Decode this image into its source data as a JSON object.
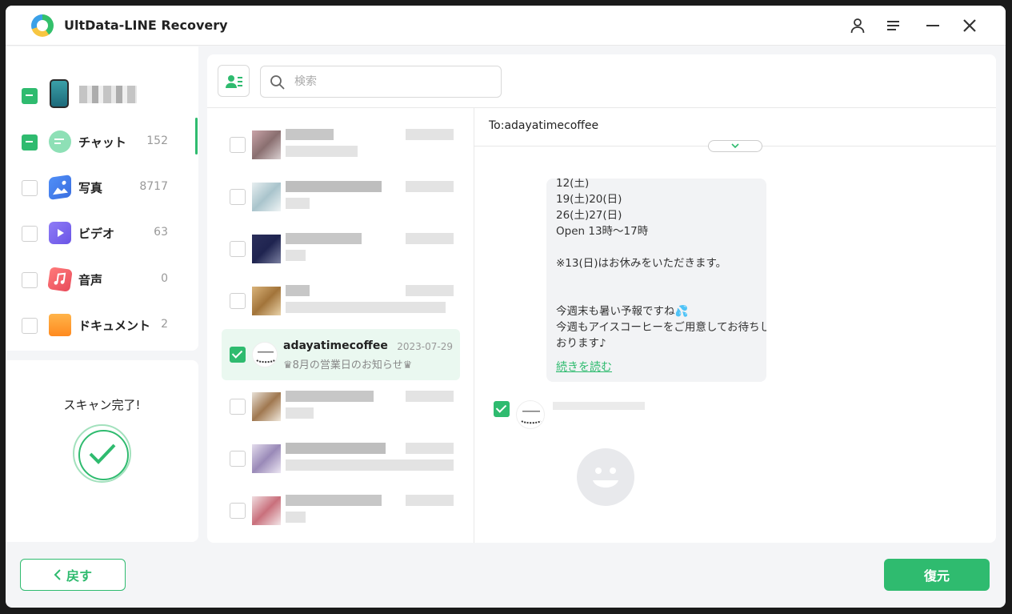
{
  "app": {
    "title": "UltData-LINE Recovery"
  },
  "titlebar": {
    "icons": [
      "user-icon",
      "menu-icon",
      "minimize-icon",
      "close-icon"
    ]
  },
  "sidebar": {
    "items": [
      {
        "label": "",
        "count": "",
        "icon": "phone-icon",
        "state": "partial"
      },
      {
        "label": "チャット",
        "count": "152",
        "icon": "chat-icon",
        "state": "partial"
      },
      {
        "label": "写真",
        "count": "8717",
        "icon": "photo-icon",
        "state": "unchecked"
      },
      {
        "label": "ビデオ",
        "count": "63",
        "icon": "video-icon",
        "state": "unchecked"
      },
      {
        "label": "音声",
        "count": "0",
        "icon": "audio-icon",
        "state": "unchecked"
      },
      {
        "label": "ドキュメント",
        "count": "2",
        "icon": "folder-icon",
        "state": "unchecked"
      }
    ],
    "scan_status": "スキャン完了!"
  },
  "search": {
    "placeholder": "検索"
  },
  "chat_list": {
    "selected": {
      "name": "adayatimecoffee",
      "date": "2023-07-29",
      "preview": "♛8月の営業日のお知らせ♛"
    }
  },
  "conversation": {
    "to": "To:adayatimecoffee",
    "message_lines": [
      "12(土)",
      "19(土)20(日)",
      "26(土)27(日)",
      "Open 13時〜17時",
      "",
      "※13(日)はお休みをいただきます。",
      "",
      "",
      "今週末も暑い予報ですね💦",
      "今週もアイスコーヒーをご用意してお待ちして",
      "おります♪"
    ],
    "read_more": "続きを読む"
  },
  "buttons": {
    "back": "戻す",
    "restore": "復元"
  },
  "colors": {
    "accent": "#2fbb6f"
  }
}
